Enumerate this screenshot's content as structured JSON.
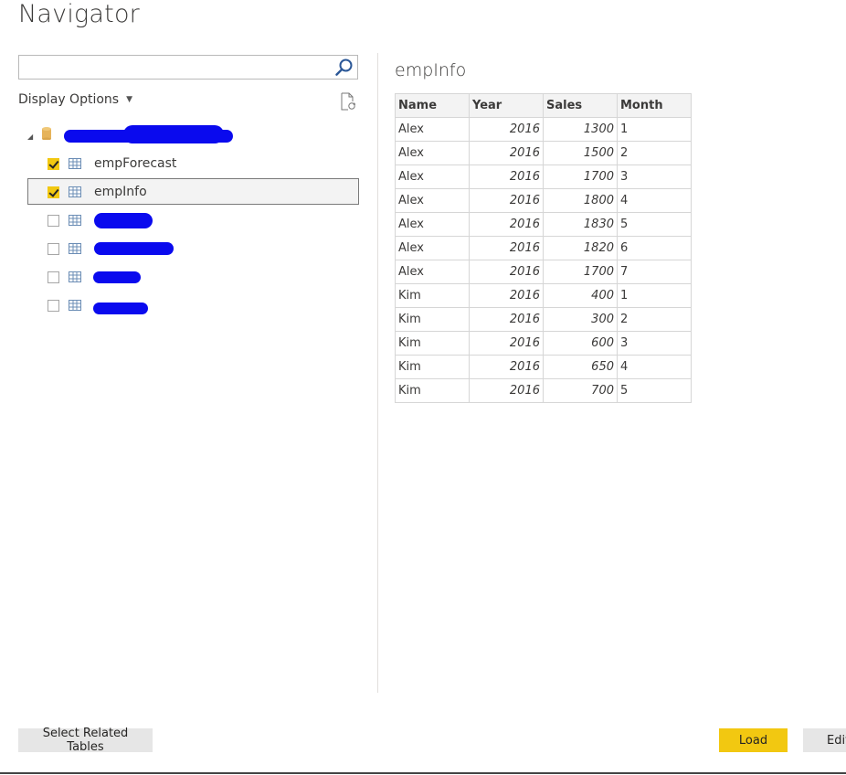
{
  "window": {
    "title": "Navigator"
  },
  "search": {
    "value": "",
    "placeholder": ""
  },
  "display_options": {
    "label": "Display Options"
  },
  "tree": {
    "items": [
      {
        "label": "empForecast",
        "checked": true
      },
      {
        "label": "empInfo",
        "checked": true,
        "selected": true
      },
      {
        "label": "",
        "checked": false
      },
      {
        "label": "",
        "checked": false
      },
      {
        "label": "",
        "checked": false
      },
      {
        "label": "",
        "checked": false
      }
    ]
  },
  "preview": {
    "title": "empInfo",
    "columns": [
      "Name",
      "Year",
      "Sales",
      "Month"
    ],
    "rows": [
      [
        "Alex",
        "2016",
        "1300",
        "1"
      ],
      [
        "Alex",
        "2016",
        "1500",
        "2"
      ],
      [
        "Alex",
        "2016",
        "1700",
        "3"
      ],
      [
        "Alex",
        "2016",
        "1800",
        "4"
      ],
      [
        "Alex",
        "2016",
        "1830",
        "5"
      ],
      [
        "Alex",
        "2016",
        "1820",
        "6"
      ],
      [
        "Alex",
        "2016",
        "1700",
        "7"
      ],
      [
        "Kim",
        "2016",
        "400",
        "1"
      ],
      [
        "Kim",
        "2016",
        "300",
        "2"
      ],
      [
        "Kim",
        "2016",
        "600",
        "3"
      ],
      [
        "Kim",
        "2016",
        "650",
        "4"
      ],
      [
        "Kim",
        "2016",
        "700",
        "5"
      ]
    ]
  },
  "buttons": {
    "select_related": "Select Related Tables",
    "load": "Load",
    "edit": "Edit"
  },
  "colors": {
    "accent": "#f2c811",
    "redaction": "#0a0aee"
  },
  "icons": [
    "search-icon",
    "refresh-icon",
    "database-icon",
    "table-icon",
    "checkmark-icon",
    "expand-arrow-icon",
    "dropdown-caret-icon"
  ]
}
